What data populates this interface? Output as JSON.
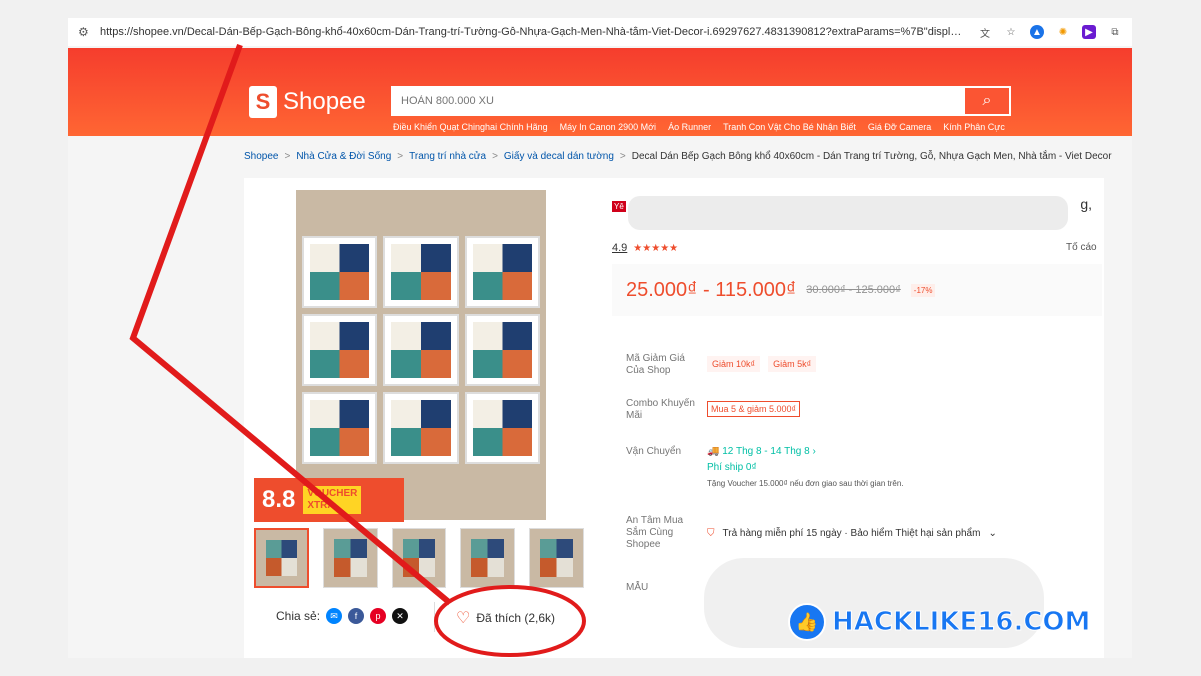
{
  "browser": {
    "url": "https://shopee.vn/Decal-Dán-Bếp-Gạch-Bông-khổ-40x60cm-Dán-Trang-trí-Tường-Gỗ-Nhựa-Gạch-Men-Nhà-tắm-Viet-Decor-i.69297627.4831390812?extraParams=%7B\"display_model..."
  },
  "header": {
    "logo": "Shopee",
    "search_placeholder": "HOÀN 800.000 XU",
    "suggestions": [
      "Điều Khiển Quạt Chinghai Chính Hãng",
      "Máy In Canon 2900 Mới",
      "Áo Runner",
      "Tranh Con Vật Cho Bé Nhận Biết",
      "Giá Đỡ Camera",
      "Kính Phân Cực"
    ]
  },
  "breadcrumb": {
    "items": [
      "Shopee",
      "Nhà Cửa & Đời Sống",
      "Trang trí nhà cửa",
      "Giấy và decal dán tường"
    ],
    "current": "Decal Dán Bếp Gạch Bông khổ 40x60cm - Dán Trang trí Tường, Gỗ, Nhựa Gạch Men, Nhà tắm - Viet Decor",
    "sep": ">"
  },
  "gallery": {
    "badge": "8.8",
    "voucher_top": "VOUCHER",
    "voucher_bottom": "XTRA"
  },
  "social": {
    "share_label": "Chia sẻ:",
    "like_label": "Đã thích (2,6k)"
  },
  "product": {
    "mall": "Yê",
    "title_tail": "g,",
    "rating": "4.9",
    "report": "Tố cáo",
    "price": "25.000₫ - 115.000₫",
    "old_price": "30.000₫ - 125.000₫",
    "discount": "-17%"
  },
  "rows": {
    "voucher_label": "Mã Giảm Giá Của Shop",
    "voucher1": "Giảm 10k₫",
    "voucher2": "Giảm 5k₫",
    "combo_label": "Combo Khuyến Mãi",
    "combo": "Mua 5 & giảm 5.000₫",
    "ship_label": "Vận Chuyển",
    "ship_date": "12 Thg 8 - 14 Thg 8",
    "ship_fee": "Phí ship 0₫",
    "ship_note": "Tặng Voucher 15.000₫ nếu đơn giao sau thời gian trên.",
    "guard_label": "An Tâm Mua Sắm Cùng Shopee",
    "guard": "Trả hàng miễn phí 15 ngày · Bảo hiểm Thiệt hại sản phẩm",
    "mau_label": "MẪU"
  },
  "watermark": {
    "text": "HACKLIKE16.COM"
  },
  "colors": {
    "brand": "#ee4d2d",
    "annotation": "#e11b1b"
  }
}
